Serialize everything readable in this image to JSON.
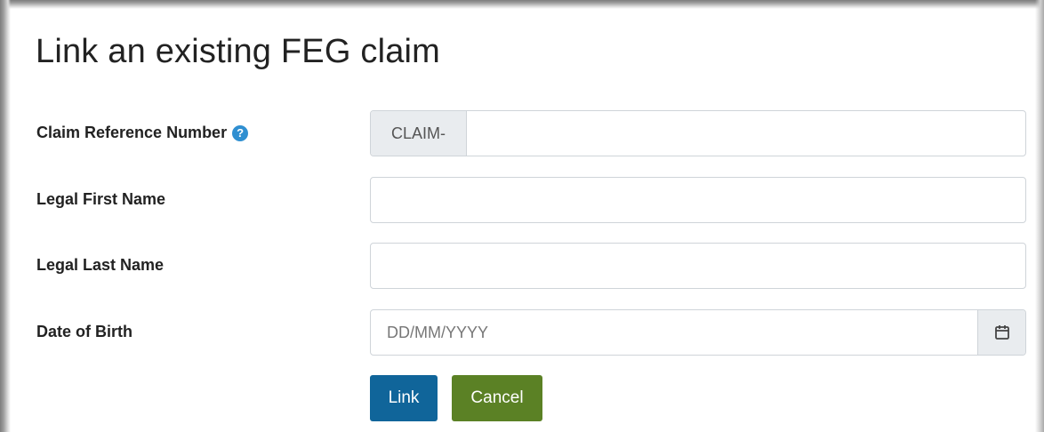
{
  "form": {
    "title": "Link an existing FEG claim",
    "fields": {
      "claim_ref": {
        "label": "Claim Reference Number",
        "prefix": "CLAIM-",
        "value": "",
        "placeholder": ""
      },
      "first_name": {
        "label": "Legal First Name",
        "value": "",
        "placeholder": ""
      },
      "last_name": {
        "label": "Legal Last Name",
        "value": "",
        "placeholder": ""
      },
      "dob": {
        "label": "Date of Birth",
        "value": "",
        "placeholder": "DD/MM/YYYY"
      }
    },
    "buttons": {
      "link_label": "Link",
      "cancel_label": "Cancel"
    }
  },
  "icons": {
    "help": "question-circle-icon",
    "calendar": "calendar-icon"
  },
  "colors": {
    "link_button": "#10659a",
    "cancel_button": "#5b8125",
    "help_icon": "#2f8fd1"
  }
}
